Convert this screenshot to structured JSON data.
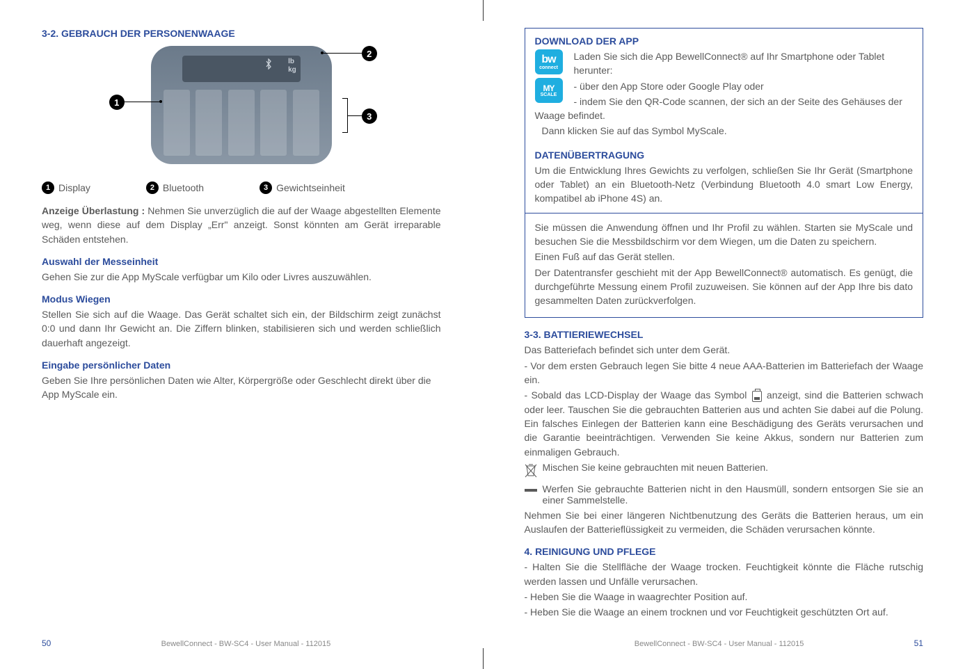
{
  "left": {
    "h_3_2": "3-2. GEBRAUCH DER PERSONENWAAGE",
    "legend": {
      "l1": "Display",
      "l2": "Bluetooth",
      "l3": "Gewichtseinheit"
    },
    "overload_label": "Anzeige Überlastung : ",
    "overload_text": "Nehmen Sie unverzüglich die auf der Waage abgestellten Elemente weg, wenn diese auf dem Display „Err\" anzeigt. Sonst könnten am Gerät irreparable Schäden entstehen.",
    "h_unit": "Auswahl der Messeinheit",
    "unit_text": "Gehen Sie zur die App MyScale verfügbar um Kilo oder Livres auszuwählen.",
    "h_weigh": "Modus Wiegen",
    "weigh_text": "Stellen Sie sich auf die Waage. Das Gerät schaltet sich ein, der Bildschirm zeigt zunächst 0:0 und dann Ihr Gewicht an. Die Ziffern blinken, stabilisieren sich und werden schließlich dauerhaft angezeigt.",
    "h_personal": "Eingabe persönlicher Daten",
    "personal_text": "Geben Sie Ihre persönlichen Daten wie Alter, Körpergröße oder Geschlecht direkt über die App MyScale ein.",
    "footer_text": "BewellConnect - BW-SC4 - User Manual - 112015",
    "page_num": "50"
  },
  "right": {
    "box": {
      "h_download": "DOWNLOAD DER APP",
      "dl1": "Laden Sie sich die App BewellConnect® auf Ihr Smartphone oder Tablet herunter:",
      "dl2": "- über den App Store oder Google Play oder",
      "dl3": "- indem Sie den QR-Code scannen, der sich an der Seite des Gehäuses der Waage befindet.",
      "dl4": "Dann klicken Sie auf das Symbol MyScale.",
      "h_data": "DATENÜBERTRAGUNG",
      "d1": "Um die Entwicklung Ihres Gewichts zu verfolgen, schließen Sie Ihr Gerät (Smartphone oder Tablet) an ein Bluetooth-Netz (Verbindung Bluetooth 4.0 smart Low Energy, kompatibel ab iPhone 4S) an.",
      "d2": "Sie müssen die Anwendung öffnen und Ihr Profil zu wählen. Starten sie MyScale und besuchen Sie die Messbildschirm vor dem Wiegen, um die Daten zu speichern.",
      "d3": "Einen Fuß auf das Gerät stellen.",
      "d4": "Der Datentransfer geschieht mit der App BewellConnect® automatisch. Es genügt, die durchgeführte Messung einem Profil zuzuweisen. Sie können auf der App Ihre bis dato gesammelten Daten zurückverfolgen."
    },
    "h_3_3": "3-3. BATTIERIEWECHSEL",
    "b1": "Das Batteriefach befindet sich unter dem Gerät.",
    "b2": "- Vor dem ersten Gebrauch legen Sie bitte 4 neue AAA-Batterien im Batteriefach der Waage ein.",
    "b3a": "- Sobald das LCD-Display der Waage das Symbol ",
    "b3b": " anzeigt, sind die Batterien schwach oder leer. Tauschen Sie die gebrauchten Batterien aus und achten Sie dabei auf die Polung. Ein falsches Einlegen der Batterien kann eine Beschädigung des Geräts verursachen und die Garantie beeinträchtigen. Verwenden Sie keine Akkus, sondern nur Batterien zum einmaligen Gebrauch.",
    "b4": "Mischen Sie keine gebrauchten mit neuen Batterien.",
    "b5": "Werfen Sie gebrauchte Batterien nicht in den Hausmüll, sondern entsorgen Sie sie an einer Sammelstelle.",
    "b6": "Nehmen Sie bei einer längeren Nichtbenutzung des Geräts die Batterien heraus, um ein Auslaufen der Batterieflüssigkeit zu vermeiden, die Schäden verursachen könnte.",
    "h_4": "4. REINIGUNG UND PFLEGE",
    "c1": "- Halten Sie die Stellfläche der Waage trocken. Feuchtigkeit könnte die Fläche rutschig werden lassen und Unfälle verursachen.",
    "c2": "- Heben Sie die Waage in waagrechter Position auf.",
    "c3": "- Heben Sie die Waage an einem trocknen und vor Feuchtigkeit geschützten Ort auf.",
    "footer_text": "BewellConnect - BW-SC4 - User Manual - 112015",
    "page_num": "51"
  },
  "icons": {
    "bw_top": "bw",
    "bw_bottom": "connect",
    "my_top": "MY",
    "my_bottom": "SCALE"
  }
}
